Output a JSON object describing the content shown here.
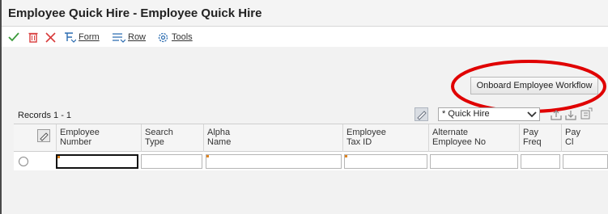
{
  "window": {
    "title": "Employee Quick Hire - Employee Quick Hire"
  },
  "toolbar": {
    "ok_icon": "checkmark-icon",
    "delete_icon": "trash-icon",
    "cancel_icon": "close-icon",
    "form_label": "Form",
    "row_label": "Row",
    "tools_label": "Tools",
    "colors": {
      "ok": "#3a9a3a",
      "cancel": "#d83b3b",
      "menu": "#2b6cb0"
    }
  },
  "actions": {
    "onboard_button": "Onboard Employee Workflow"
  },
  "annotation": {
    "shape": "ellipse",
    "color": "#e00000"
  },
  "grid": {
    "records_label": "Records 1 - 1",
    "view_select": "* Quick Hire",
    "columns": [
      "Employee Number",
      "Search Type",
      "Alpha Name",
      "Employee Tax ID",
      "Alternate Employee No",
      "Pay Freq",
      "Pay Cl"
    ],
    "column_lines": [
      [
        "Employee",
        "Number"
      ],
      [
        "Search",
        "Type"
      ],
      [
        "Alpha",
        "Name"
      ],
      [
        "Employee",
        "Tax ID"
      ],
      [
        "Alternate",
        "Employee No"
      ],
      [
        "Pay",
        "Freq"
      ],
      [
        "Pay",
        "Cl"
      ]
    ],
    "row_values": [
      "",
      "",
      "",
      "",
      "",
      "",
      ""
    ]
  }
}
